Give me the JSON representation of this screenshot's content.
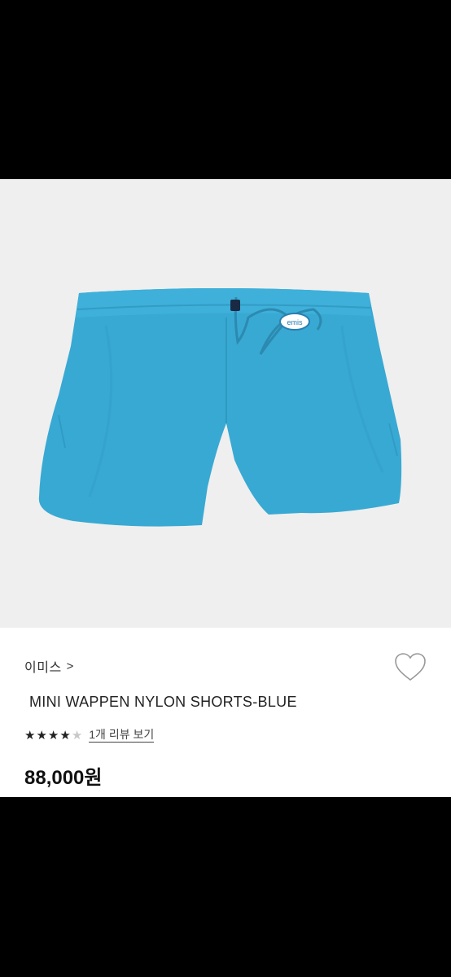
{
  "product": {
    "brand": "이미스",
    "brand_chevron": ">",
    "name": "MINI WAPPEN NYLON SHORTS-BLUE",
    "rating_value": 4,
    "rating_max": 5,
    "review_link": "1개 리뷰 보기",
    "price": "88,000원",
    "image_icon": "shorts-product-image",
    "patch_text": "emis",
    "colors": {
      "shorts": "#37aad4",
      "background": "#efefef",
      "star_on": "#222222",
      "star_off": "#c8c8c8"
    }
  },
  "icons": {
    "wishlist": "heart-icon",
    "star": "star-icon"
  }
}
